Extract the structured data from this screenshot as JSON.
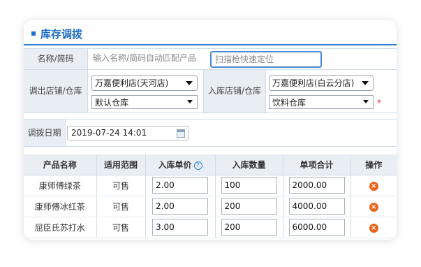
{
  "title": "库存调拨",
  "form": {
    "name_label": "名称/简码",
    "name_placeholder": "输入名称/简码自动匹配产品",
    "scan_placeholder": "扫描枪快速定位",
    "out_label": "调出店铺/仓库",
    "out_store": "万嘉便利店(天河店)",
    "out_warehouse": "默认仓库",
    "in_label": "入库店铺/仓库",
    "in_store": "万嘉便利店(白云分店)",
    "in_warehouse": "饮料仓库",
    "required_mark": "*",
    "date_label": "调拨日期",
    "date_value": "2019-07-24 14:01"
  },
  "table": {
    "headers": [
      "产品名称",
      "适用范围",
      "入库单价",
      "入库数量",
      "单项合计",
      "操作"
    ],
    "help_icon": "?",
    "rows": [
      {
        "name": "康师傅绿茶",
        "scope": "可售",
        "price": "2.00",
        "qty": "100",
        "total": "2000.00"
      },
      {
        "name": "康师傅冰红茶",
        "scope": "可售",
        "price": "2.00",
        "qty": "200",
        "total": "4000.00"
      },
      {
        "name": "屈臣氏苏打水",
        "scope": "可售",
        "price": "3.00",
        "qty": "200",
        "total": "6000.00"
      }
    ],
    "delete_icon": "×"
  },
  "colors": {
    "accent": "#1e6cc8",
    "delete": "#e8641c",
    "required": "#e22233"
  }
}
